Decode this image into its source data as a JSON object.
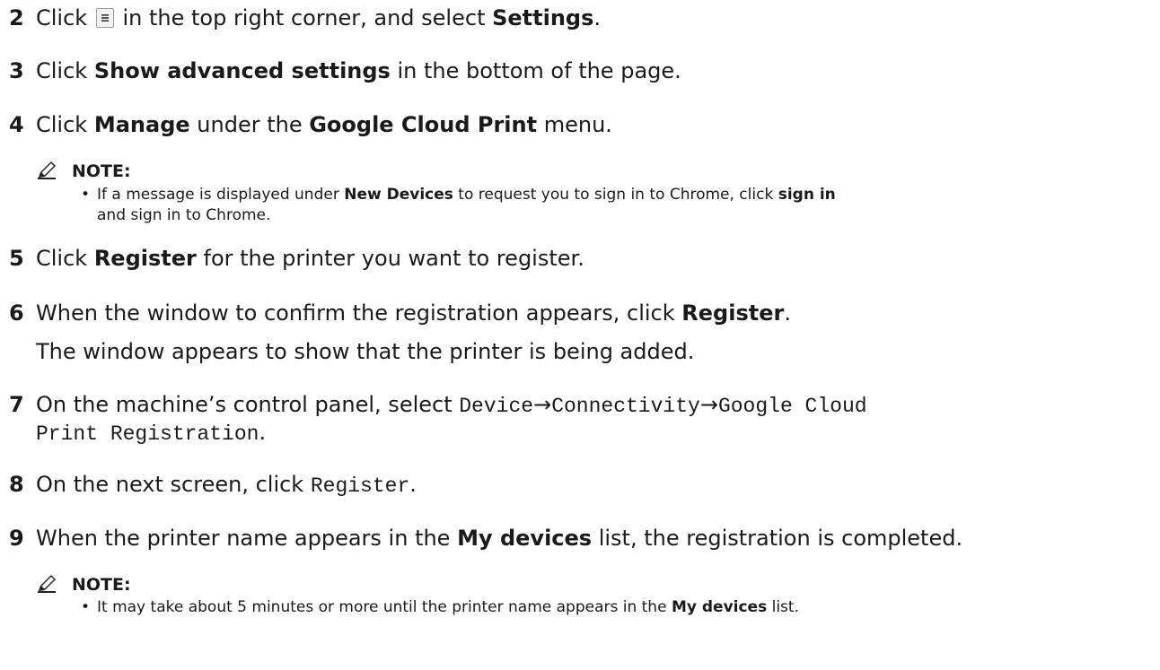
{
  "steps": [
    {
      "num": "2",
      "t1": "Click ",
      "t2": " in the top right corner, and select ",
      "b1": "Settings",
      "t3": "."
    },
    {
      "num": "3",
      "t1": "Click ",
      "b1": "Show advanced settings",
      "t2": " in the bottom of the page."
    },
    {
      "num": "4",
      "t1": "Click ",
      "b1": "Manage",
      "t2": " under the ",
      "b2": "Google Cloud Print",
      "t3": " menu."
    },
    {
      "num": "5",
      "t1": "Click ",
      "b1": "Register",
      "t2": " for the printer you want to register."
    },
    {
      "num": "6",
      "t1": "When the window to confirm the registration appears, click ",
      "b1": "Register",
      "t2": ".",
      "cont": "The window appears to show that the printer is being added."
    },
    {
      "num": "7",
      "t1": "On the machine’s control panel, select ",
      "m1": "Device",
      "arrow1": "→",
      "m2": "Connectivity",
      "arrow2": "→",
      "m3": "Google Cloud",
      "m4": "Print Registration",
      "t2": "."
    },
    {
      "num": "8",
      "t1": "On the next screen, click ",
      "m1": "Register",
      "t2": "."
    },
    {
      "num": "9",
      "t1": "When the printer name appears in the ",
      "b1": "My devices",
      "t2": " list, the registration is completed."
    }
  ],
  "notes": [
    {
      "label": "NOTE:",
      "bullet": "•",
      "line1_a": "If a message is displayed under ",
      "line1_b": "New Devices",
      "line1_c": " to request you to sign in to Chrome, click ",
      "line1_d": "sign in",
      "line2": "and sign in to Chrome."
    },
    {
      "label": "NOTE:",
      "bullet": "•",
      "line1_a": "It may take about 5 minutes or more until the printer name appears in the ",
      "line1_b": "My devices",
      "line1_c": " list."
    }
  ],
  "icons": {
    "menu": "menu-icon",
    "note": "pencil-note-icon"
  }
}
